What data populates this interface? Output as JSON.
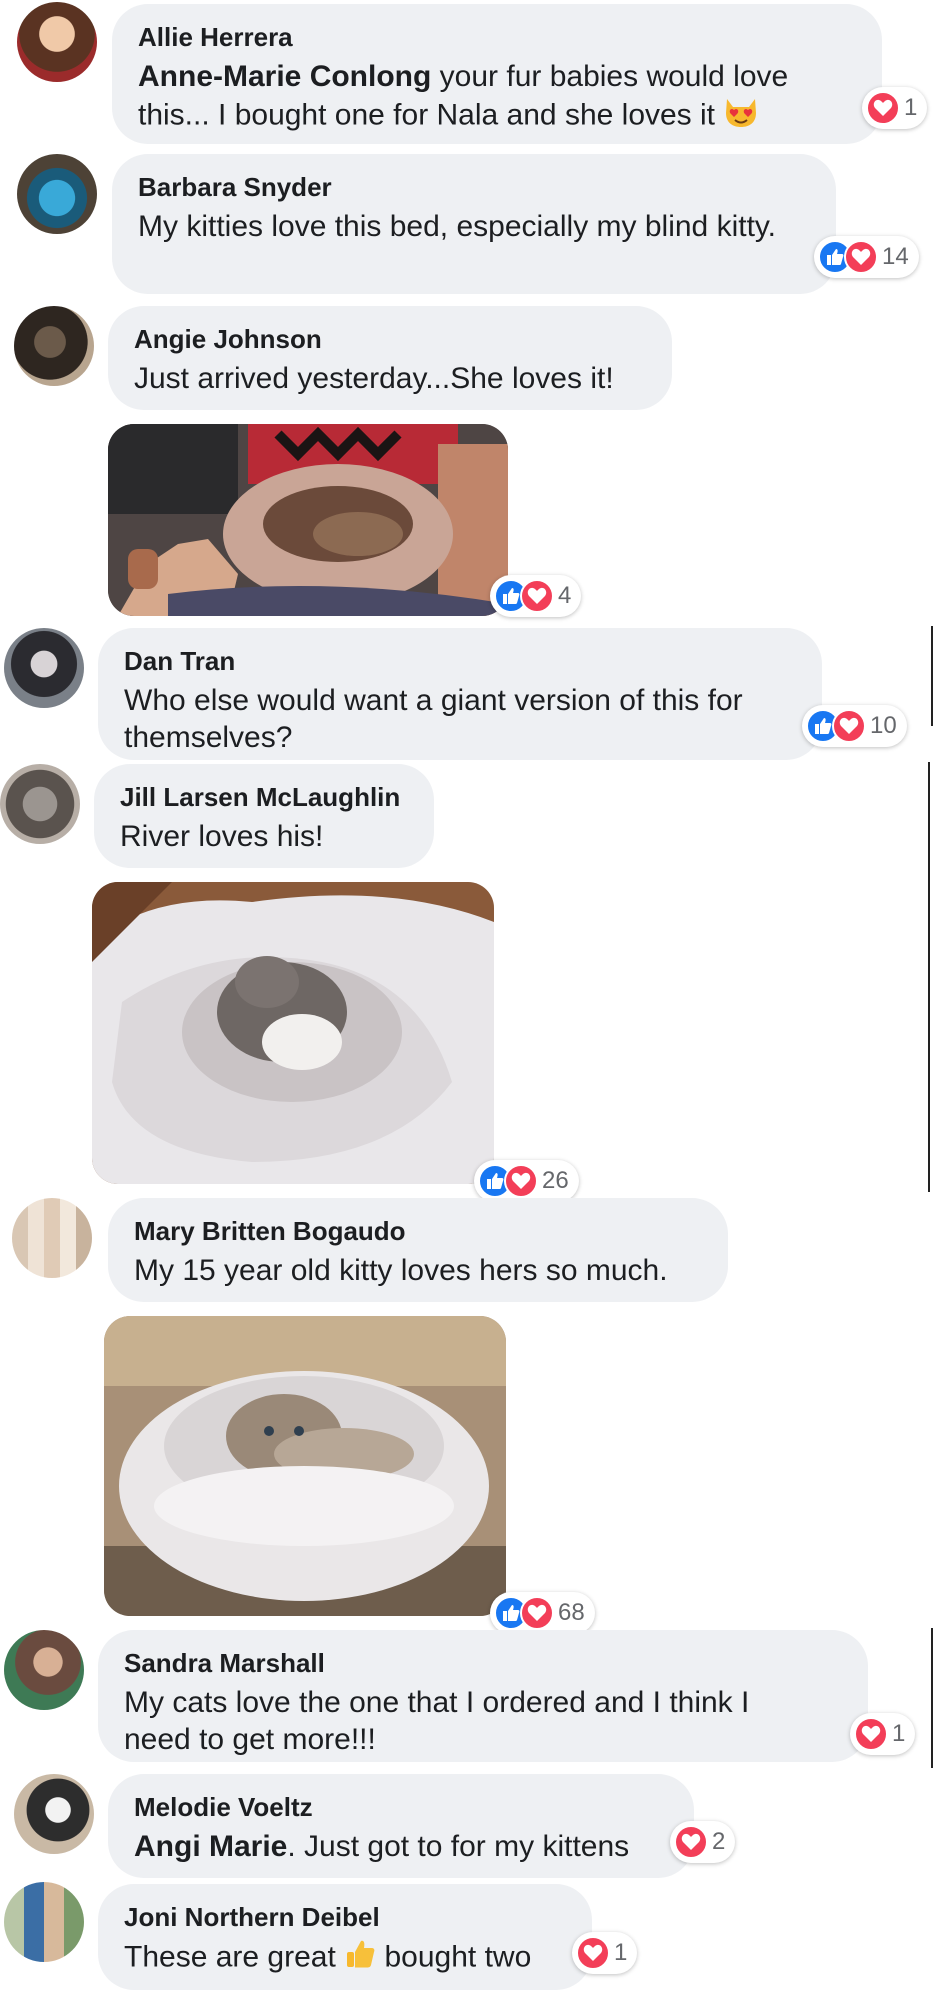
{
  "comments": [
    {
      "author": "Allie Herrera",
      "mention": "Anne-Marie Conlong",
      "text": " your fur babies would love this... I bought one for Nala and she loves it",
      "emoji": "heart-eyes-cat",
      "reactions": {
        "types": [
          "love"
        ],
        "count": "1"
      }
    },
    {
      "author": "Barbara Snyder",
      "text": "My kitties love this bed, especially my blind kitty.",
      "reactions": {
        "types": [
          "like",
          "love"
        ],
        "count": "14"
      }
    },
    {
      "author": "Angie Johnson",
      "text": "Just arrived yesterday...She loves it!",
      "photo": "cat-in-pink-fluffy-bed-photo",
      "reactions": {
        "types": [
          "like",
          "love"
        ],
        "count": "4"
      }
    },
    {
      "author": "Dan Tran",
      "text": "Who else would want a giant version of this for themselves?",
      "reactions": {
        "types": [
          "like",
          "love"
        ],
        "count": "10"
      }
    },
    {
      "author": "Jill Larsen McLaughlin",
      "text": "River loves his!",
      "photo": "cat-in-white-fluffy-bed-photo",
      "reactions": {
        "types": [
          "like",
          "love"
        ],
        "count": "26"
      }
    },
    {
      "author": "Mary Britten Bogaudo",
      "text": "My 15 year old kitty loves hers so much.",
      "photo": "siamese-cat-in-fluffy-bed-photo",
      "reactions": {
        "types": [
          "like",
          "love"
        ],
        "count": "68"
      }
    },
    {
      "author": "Sandra Marshall",
      "text": "My cats love the one that I ordered and I think I need to get more!!!",
      "reactions": {
        "types": [
          "love"
        ],
        "count": "1"
      }
    },
    {
      "author": "Melodie Voeltz",
      "mention": "Angi Marie",
      "text": ". Just got to for my kittens",
      "reactions": {
        "types": [
          "love"
        ],
        "count": "2"
      }
    },
    {
      "author": "Joni Northern Deibel",
      "text_before": "These are great",
      "emoji": "thumbs-up",
      "text_after": "bought two",
      "reactions": {
        "types": [
          "love"
        ],
        "count": "1"
      }
    }
  ],
  "colors": {
    "bubble": "#eef0f3",
    "like": "#1877f2",
    "love": "#f33e58",
    "count": "#65676b"
  }
}
